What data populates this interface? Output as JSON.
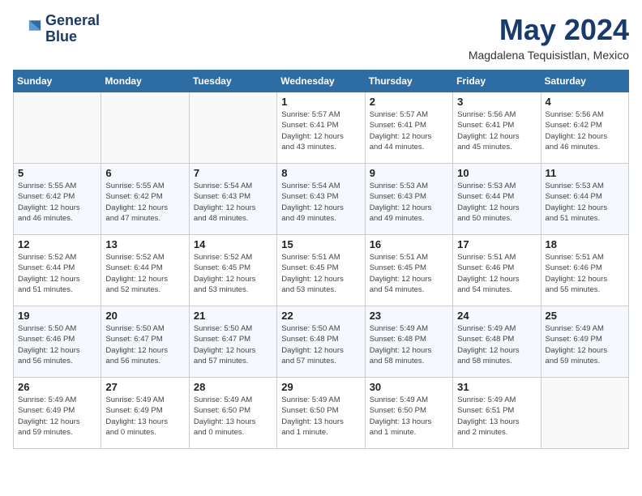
{
  "header": {
    "logo_line1": "General",
    "logo_line2": "Blue",
    "month": "May 2024",
    "location": "Magdalena Tequisistlan, Mexico"
  },
  "weekdays": [
    "Sunday",
    "Monday",
    "Tuesday",
    "Wednesday",
    "Thursday",
    "Friday",
    "Saturday"
  ],
  "weeks": [
    [
      {
        "day": "",
        "info": ""
      },
      {
        "day": "",
        "info": ""
      },
      {
        "day": "",
        "info": ""
      },
      {
        "day": "1",
        "info": "Sunrise: 5:57 AM\nSunset: 6:41 PM\nDaylight: 12 hours\nand 43 minutes."
      },
      {
        "day": "2",
        "info": "Sunrise: 5:57 AM\nSunset: 6:41 PM\nDaylight: 12 hours\nand 44 minutes."
      },
      {
        "day": "3",
        "info": "Sunrise: 5:56 AM\nSunset: 6:41 PM\nDaylight: 12 hours\nand 45 minutes."
      },
      {
        "day": "4",
        "info": "Sunrise: 5:56 AM\nSunset: 6:42 PM\nDaylight: 12 hours\nand 46 minutes."
      }
    ],
    [
      {
        "day": "5",
        "info": "Sunrise: 5:55 AM\nSunset: 6:42 PM\nDaylight: 12 hours\nand 46 minutes."
      },
      {
        "day": "6",
        "info": "Sunrise: 5:55 AM\nSunset: 6:42 PM\nDaylight: 12 hours\nand 47 minutes."
      },
      {
        "day": "7",
        "info": "Sunrise: 5:54 AM\nSunset: 6:43 PM\nDaylight: 12 hours\nand 48 minutes."
      },
      {
        "day": "8",
        "info": "Sunrise: 5:54 AM\nSunset: 6:43 PM\nDaylight: 12 hours\nand 49 minutes."
      },
      {
        "day": "9",
        "info": "Sunrise: 5:53 AM\nSunset: 6:43 PM\nDaylight: 12 hours\nand 49 minutes."
      },
      {
        "day": "10",
        "info": "Sunrise: 5:53 AM\nSunset: 6:44 PM\nDaylight: 12 hours\nand 50 minutes."
      },
      {
        "day": "11",
        "info": "Sunrise: 5:53 AM\nSunset: 6:44 PM\nDaylight: 12 hours\nand 51 minutes."
      }
    ],
    [
      {
        "day": "12",
        "info": "Sunrise: 5:52 AM\nSunset: 6:44 PM\nDaylight: 12 hours\nand 51 minutes."
      },
      {
        "day": "13",
        "info": "Sunrise: 5:52 AM\nSunset: 6:44 PM\nDaylight: 12 hours\nand 52 minutes."
      },
      {
        "day": "14",
        "info": "Sunrise: 5:52 AM\nSunset: 6:45 PM\nDaylight: 12 hours\nand 53 minutes."
      },
      {
        "day": "15",
        "info": "Sunrise: 5:51 AM\nSunset: 6:45 PM\nDaylight: 12 hours\nand 53 minutes."
      },
      {
        "day": "16",
        "info": "Sunrise: 5:51 AM\nSunset: 6:45 PM\nDaylight: 12 hours\nand 54 minutes."
      },
      {
        "day": "17",
        "info": "Sunrise: 5:51 AM\nSunset: 6:46 PM\nDaylight: 12 hours\nand 54 minutes."
      },
      {
        "day": "18",
        "info": "Sunrise: 5:51 AM\nSunset: 6:46 PM\nDaylight: 12 hours\nand 55 minutes."
      }
    ],
    [
      {
        "day": "19",
        "info": "Sunrise: 5:50 AM\nSunset: 6:46 PM\nDaylight: 12 hours\nand 56 minutes."
      },
      {
        "day": "20",
        "info": "Sunrise: 5:50 AM\nSunset: 6:47 PM\nDaylight: 12 hours\nand 56 minutes."
      },
      {
        "day": "21",
        "info": "Sunrise: 5:50 AM\nSunset: 6:47 PM\nDaylight: 12 hours\nand 57 minutes."
      },
      {
        "day": "22",
        "info": "Sunrise: 5:50 AM\nSunset: 6:48 PM\nDaylight: 12 hours\nand 57 minutes."
      },
      {
        "day": "23",
        "info": "Sunrise: 5:49 AM\nSunset: 6:48 PM\nDaylight: 12 hours\nand 58 minutes."
      },
      {
        "day": "24",
        "info": "Sunrise: 5:49 AM\nSunset: 6:48 PM\nDaylight: 12 hours\nand 58 minutes."
      },
      {
        "day": "25",
        "info": "Sunrise: 5:49 AM\nSunset: 6:49 PM\nDaylight: 12 hours\nand 59 minutes."
      }
    ],
    [
      {
        "day": "26",
        "info": "Sunrise: 5:49 AM\nSunset: 6:49 PM\nDaylight: 12 hours\nand 59 minutes."
      },
      {
        "day": "27",
        "info": "Sunrise: 5:49 AM\nSunset: 6:49 PM\nDaylight: 13 hours\nand 0 minutes."
      },
      {
        "day": "28",
        "info": "Sunrise: 5:49 AM\nSunset: 6:50 PM\nDaylight: 13 hours\nand 0 minutes."
      },
      {
        "day": "29",
        "info": "Sunrise: 5:49 AM\nSunset: 6:50 PM\nDaylight: 13 hours\nand 1 minute."
      },
      {
        "day": "30",
        "info": "Sunrise: 5:49 AM\nSunset: 6:50 PM\nDaylight: 13 hours\nand 1 minute."
      },
      {
        "day": "31",
        "info": "Sunrise: 5:49 AM\nSunset: 6:51 PM\nDaylight: 13 hours\nand 2 minutes."
      },
      {
        "day": "",
        "info": ""
      }
    ]
  ]
}
